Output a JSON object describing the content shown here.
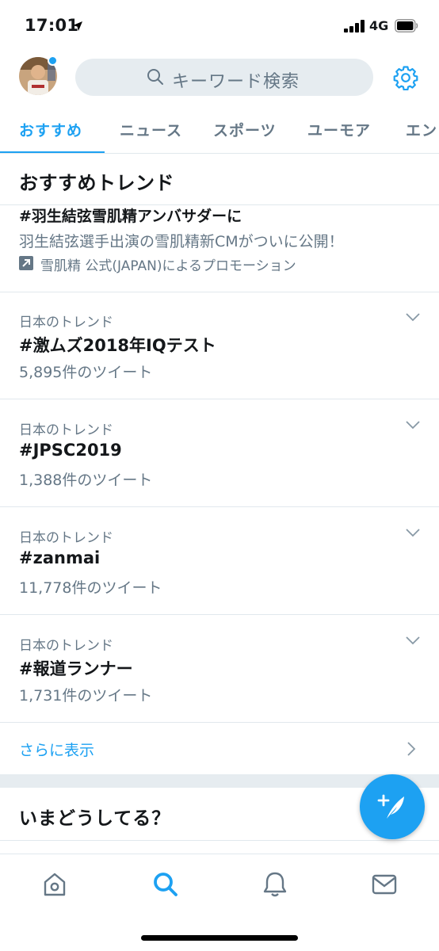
{
  "status_bar": {
    "time": "17:01",
    "network": "4G"
  },
  "header": {
    "search_placeholder": "キーワード検索"
  },
  "tabs": [
    {
      "label": "おすすめ",
      "active": true
    },
    {
      "label": "ニュース",
      "active": false
    },
    {
      "label": "スポーツ",
      "active": false
    },
    {
      "label": "ユーモア",
      "active": false
    },
    {
      "label": "エン",
      "active": false
    }
  ],
  "trends_section": {
    "title": "おすすめトレンド",
    "promoted": {
      "name": "#羽生結弦雪肌精アンバサダーに",
      "description": "羽生結弦選手出演の雪肌精新CMがついに公開！",
      "promoter": "雪肌精 公式(JAPAN)によるプロモーション"
    },
    "items": [
      {
        "context": "日本のトレンド",
        "name": "#激ムズ2018年IQテスト",
        "count": "5,895件のツイート"
      },
      {
        "context": "日本のトレンド",
        "name": "#JPSC2019",
        "count": "1,388件のツイート"
      },
      {
        "context": "日本のトレンド",
        "name": "#zanmai",
        "count": "11,778件のツイート"
      },
      {
        "context": "日本のトレンド",
        "name": "#報道ランナー",
        "count": "1,731件のツイート"
      }
    ],
    "show_more": "さらに表示"
  },
  "whats_happening": {
    "title": "いまどうしてる？"
  },
  "colors": {
    "accent": "#1da1f2",
    "secondary_text": "#657786",
    "divider": "#e1e8ed"
  },
  "icons": {
    "tweet_fab": "feather-plus-icon",
    "nav": [
      "home-icon",
      "search-icon",
      "bell-icon",
      "mail-icon"
    ]
  }
}
